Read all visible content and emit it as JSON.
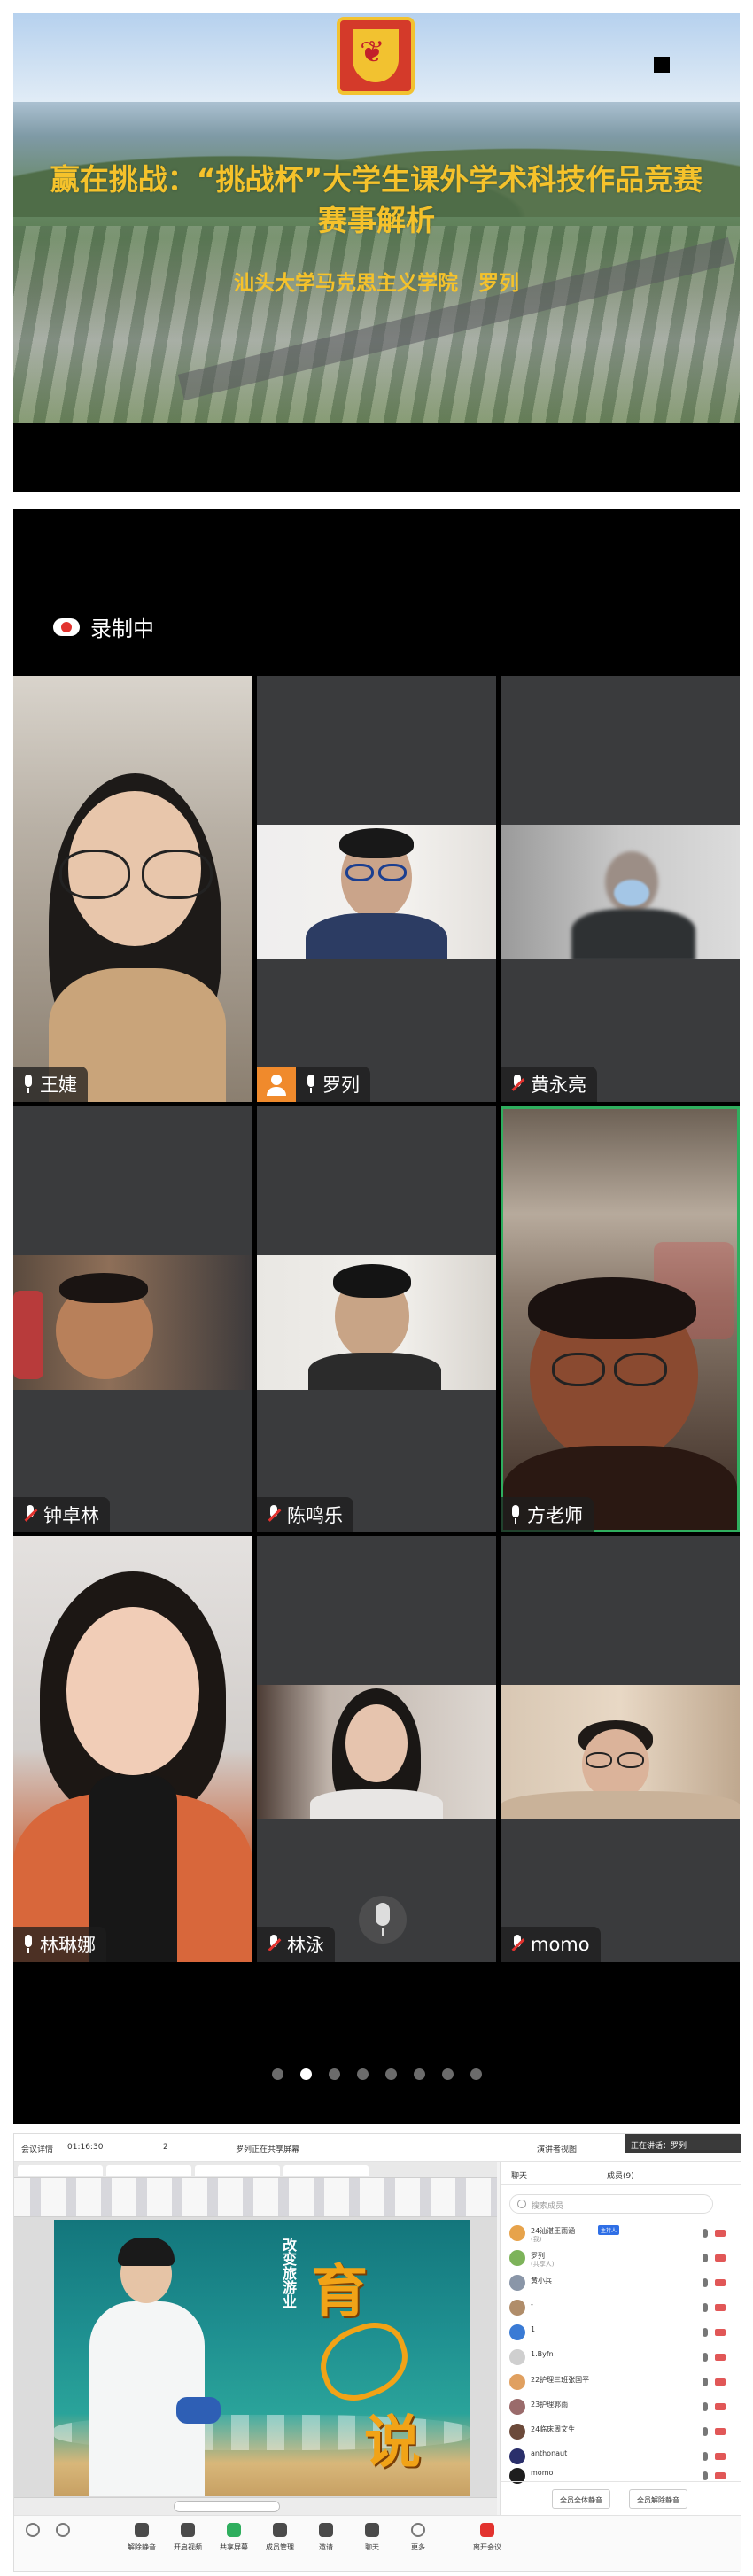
{
  "slide": {
    "title_line1": "赢在挑战：“挑战杯”大学生课外学术科技作品竞赛",
    "title_line2": "赛事解析",
    "subtitle": "汕头大学马克思主义学院　罗列"
  },
  "meeting": {
    "recording_label": "录制中",
    "page_count": 8,
    "active_page": 2,
    "participants": [
      {
        "name": "王婕",
        "muted": false
      },
      {
        "name": "罗列",
        "muted": false
      },
      {
        "name": "黄永亮",
        "muted": true
      },
      {
        "name": "钟卓林",
        "muted": true
      },
      {
        "name": "陈鸣乐",
        "muted": true
      },
      {
        "name": "方老师",
        "muted": false
      },
      {
        "name": "林琳娜",
        "muted": false
      },
      {
        "name": "林泳",
        "muted": true
      },
      {
        "name": "momo",
        "muted": true
      }
    ]
  },
  "desktop": {
    "topbar": {
      "info": "会议详情",
      "time": "01:16:30",
      "participants_count": "2",
      "sharing_text": "罗列正在共享屏幕",
      "view_label": "演讲者视图",
      "speaking_text": "正在讲话：罗列"
    },
    "doc": {
      "vertical_text": "改变旅游业",
      "big_char_1": "育",
      "big_char_2": "说"
    },
    "side": {
      "tab_chat": "聊天",
      "tab_members": "成员(9)",
      "search_placeholder": "搜索成员",
      "host_badge": "主持人",
      "members": [
        {
          "name": "24汕湛王雨涵",
          "sub": "(我)"
        },
        {
          "name": "罗列",
          "sub": "(共享人)"
        },
        {
          "name": "黄小兵",
          "sub": ""
        },
        {
          "name": "-",
          "sub": ""
        },
        {
          "name": "1",
          "sub": ""
        },
        {
          "name": "1.Byfn",
          "sub": ""
        },
        {
          "name": "22护理三班张国平",
          "sub": ""
        },
        {
          "name": "23护理郭雨",
          "sub": ""
        },
        {
          "name": "24临床周文生",
          "sub": ""
        },
        {
          "name": "anthonaut",
          "sub": ""
        },
        {
          "name": "momo",
          "sub": ""
        }
      ],
      "btn_mute_all": "全员全体静音",
      "btn_unmute_all": "全员解除静音"
    },
    "toolbar": {
      "items": [
        "解除静音",
        "开启视频",
        "共享屏幕",
        "成员管理",
        "邀请",
        "聊天",
        "更多",
        "离开会议"
      ]
    }
  }
}
